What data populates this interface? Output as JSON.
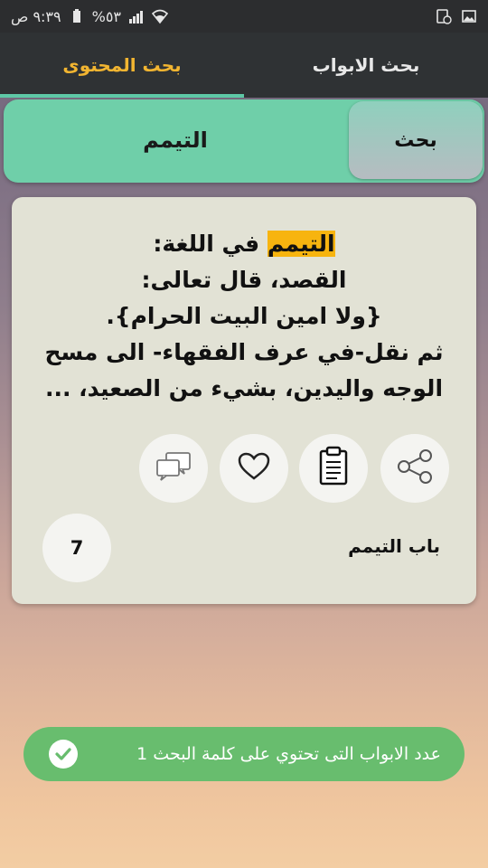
{
  "status_bar": {
    "time": "٩:٣٩ ص",
    "battery": "%٥٣",
    "icons": [
      "battery-icon",
      "signal-icon",
      "wifi-icon",
      "screen-icon",
      "image-icon"
    ]
  },
  "tabs": [
    {
      "label": "بحث المحتوى",
      "active": true
    },
    {
      "label": "بحث الابواب",
      "active": false
    }
  ],
  "search": {
    "button_label": "بحث",
    "query": "التيمم"
  },
  "result_card": {
    "highlight": "التيمم",
    "line1_rest": " في اللغة:",
    "line2": "القصد، قال تعالى:",
    "line3": "{ولا امين البيت الحرام}.",
    "line4": "ثم نقل-في عرف الفقهاء- الى مسح",
    "line5": "الوجه واليدين، بشيء من الصعيد، ...",
    "chapter": "باب التيمم",
    "count": "7",
    "actions": [
      "share-icon",
      "clipboard-icon",
      "heart-icon",
      "comments-icon"
    ]
  },
  "toast": {
    "text": "عدد الابواب التى تحتوي على كلمة البحث 1"
  },
  "colors": {
    "accent": "#5ec8a6",
    "active_tab": "#f2b531",
    "highlight": "#f7b40f",
    "toast": "#68bd6e"
  }
}
